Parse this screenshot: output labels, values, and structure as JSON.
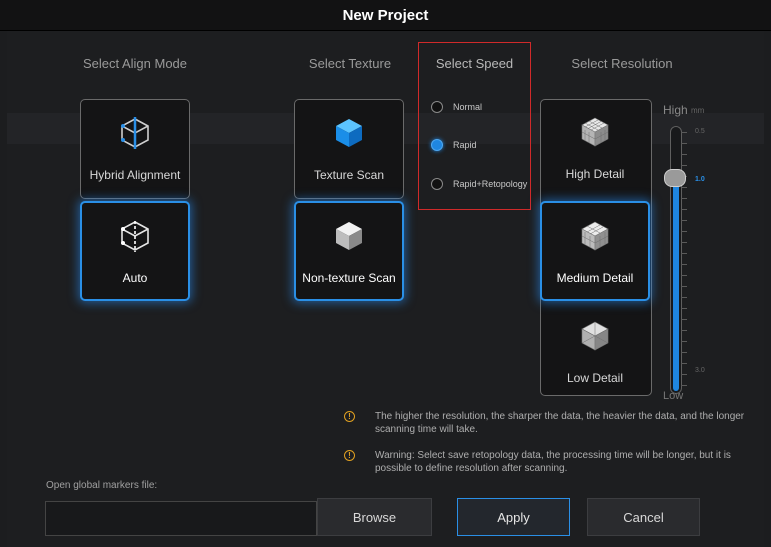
{
  "window": {
    "title": "New Project"
  },
  "align": {
    "title": "Select Align Mode",
    "options": [
      {
        "label": "Hybrid Alignment",
        "selected": false,
        "icon": "hybrid-align-cube-icon"
      },
      {
        "label": "Auto",
        "selected": true,
        "icon": "auto-align-cube-icon"
      }
    ]
  },
  "texture": {
    "title": "Select Texture",
    "options": [
      {
        "label": "Texture Scan",
        "selected": false,
        "icon": "texture-cube-icon"
      },
      {
        "label": "Non-texture Scan",
        "selected": true,
        "icon": "non-texture-cube-icon"
      }
    ]
  },
  "speed": {
    "title": "Select Speed",
    "options": [
      {
        "label": "Normal",
        "selected": false
      },
      {
        "label": "Rapid",
        "selected": true
      },
      {
        "label": "Rapid+Retopology",
        "selected": false
      }
    ]
  },
  "resolution": {
    "title": "Select Resolution",
    "options": [
      {
        "label": "High Detail",
        "selected": false,
        "icon": "mesh-cube-icon"
      },
      {
        "label": "Medium Detail",
        "selected": true,
        "icon": "mesh-cube-icon"
      },
      {
        "label": "Low Detail",
        "selected": false,
        "icon": "mesh-cube-icon"
      }
    ],
    "slider": {
      "high_label": "High",
      "unit": "mm",
      "low_label": "Low",
      "max_value": "0.5",
      "current_value": "1.0",
      "min_value": "3.0"
    }
  },
  "notes": [
    "The higher the resolution, the sharper the data, the heavier the data, and the longer scanning time will take.",
    "Warning: Select save retopology data, the processing time will be longer, but it is possible to define resolution after scanning."
  ],
  "notes_icon": "!",
  "markers": {
    "label": "Open global markers file:",
    "value": ""
  },
  "buttons": {
    "browse": "Browse",
    "apply": "Apply",
    "cancel": "Cancel"
  },
  "colors": {
    "accent": "#2a8fe6",
    "speed_highlight": "#d02a2a",
    "warning": "#e0a020"
  }
}
